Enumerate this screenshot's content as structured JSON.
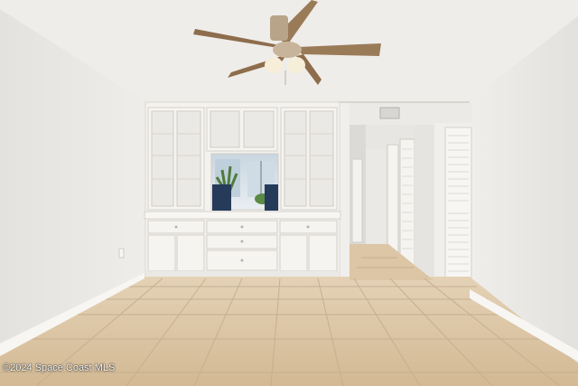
{
  "watermark": {
    "text": "©2024 Space Coast MLS"
  },
  "colors": {
    "wall": "#eceae7",
    "ceiling": "#efedea",
    "cabinet": "#f4f2ee",
    "floor": "#d9c2a4",
    "grout": "#c4ad8e",
    "fan_blade": "#9a7b58",
    "fan_body": "#b8a488",
    "hallway": "#e8e6e2"
  },
  "scene": {
    "ceiling_fan": "ceiling-fan",
    "built_in_cabinet": "built-in-cabinet",
    "hallway": "hallway",
    "closet_doors": "louvered-closet-doors"
  }
}
